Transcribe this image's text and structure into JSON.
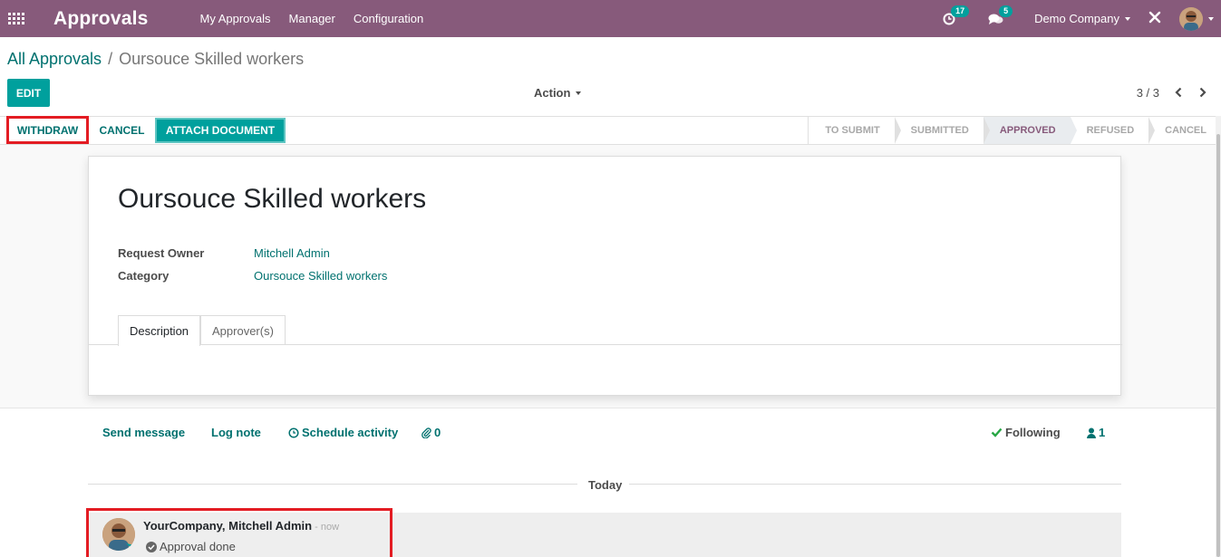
{
  "navbar": {
    "app_title": "Approvals",
    "menu": [
      "My Approvals",
      "Manager",
      "Configuration"
    ],
    "activity_count": "17",
    "message_count": "5",
    "company": "Demo Company"
  },
  "breadcrumb": {
    "parent": "All Approvals",
    "separator": "/",
    "current": "Oursouce Skilled workers"
  },
  "control_panel": {
    "edit_label": "EDIT",
    "action_label": "Action",
    "pager": "3 / 3"
  },
  "statusbar": {
    "buttons": [
      "WITHDRAW",
      "CANCEL",
      "ATTACH DOCUMENT"
    ],
    "stages": [
      "TO SUBMIT",
      "SUBMITTED",
      "APPROVED",
      "REFUSED",
      "CANCEL"
    ],
    "active_stage": "APPROVED"
  },
  "form": {
    "title": "Oursouce Skilled workers",
    "fields": [
      {
        "label": "Request Owner",
        "value": "Mitchell Admin"
      },
      {
        "label": "Category",
        "value": "Oursouce Skilled workers"
      }
    ],
    "tabs": [
      "Description",
      "Approver(s)"
    ]
  },
  "chatter": {
    "send_message": "Send message",
    "log_note": "Log note",
    "schedule_activity": "Schedule activity",
    "attachments": "0",
    "following": "Following",
    "followers": "1",
    "date_separator": "Today",
    "message": {
      "author": "YourCompany, Mitchell Admin",
      "time": "- now",
      "body": "Approval done"
    }
  },
  "colors": {
    "navbar": "#875a7b",
    "primary": "#00a09d",
    "link": "#00716f",
    "highlight": "#e31c23"
  }
}
